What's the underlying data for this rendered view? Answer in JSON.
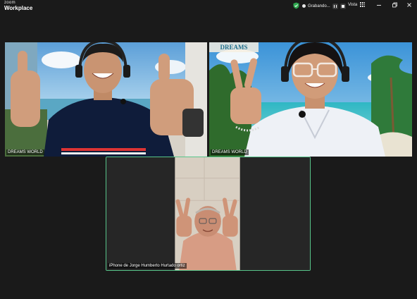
{
  "app": {
    "logo_top": "zoom",
    "logo_bottom": "Workplace"
  },
  "toolbar": {
    "recording_label": "Grabando...",
    "view_label": "Vista"
  },
  "icons": {
    "security": "shield-check-icon",
    "recording": "record-dot-icon",
    "pause": "pause-icon",
    "stop": "stop-icon",
    "view": "grid-view-icon",
    "minimize": "minimize-icon",
    "restore": "restore-icon",
    "close": "close-icon"
  },
  "colors": {
    "background": "#1a1a1a",
    "speaker_border": "#57c58a",
    "security_green": "#2ea84f"
  },
  "participants": [
    {
      "name": "DREAMS WORLD"
    },
    {
      "name": "DREAMS WORLD",
      "background_sign": "DREAMS"
    },
    {
      "name": "iPhone de Jorge Humberto Hurtado ortiz"
    }
  ]
}
